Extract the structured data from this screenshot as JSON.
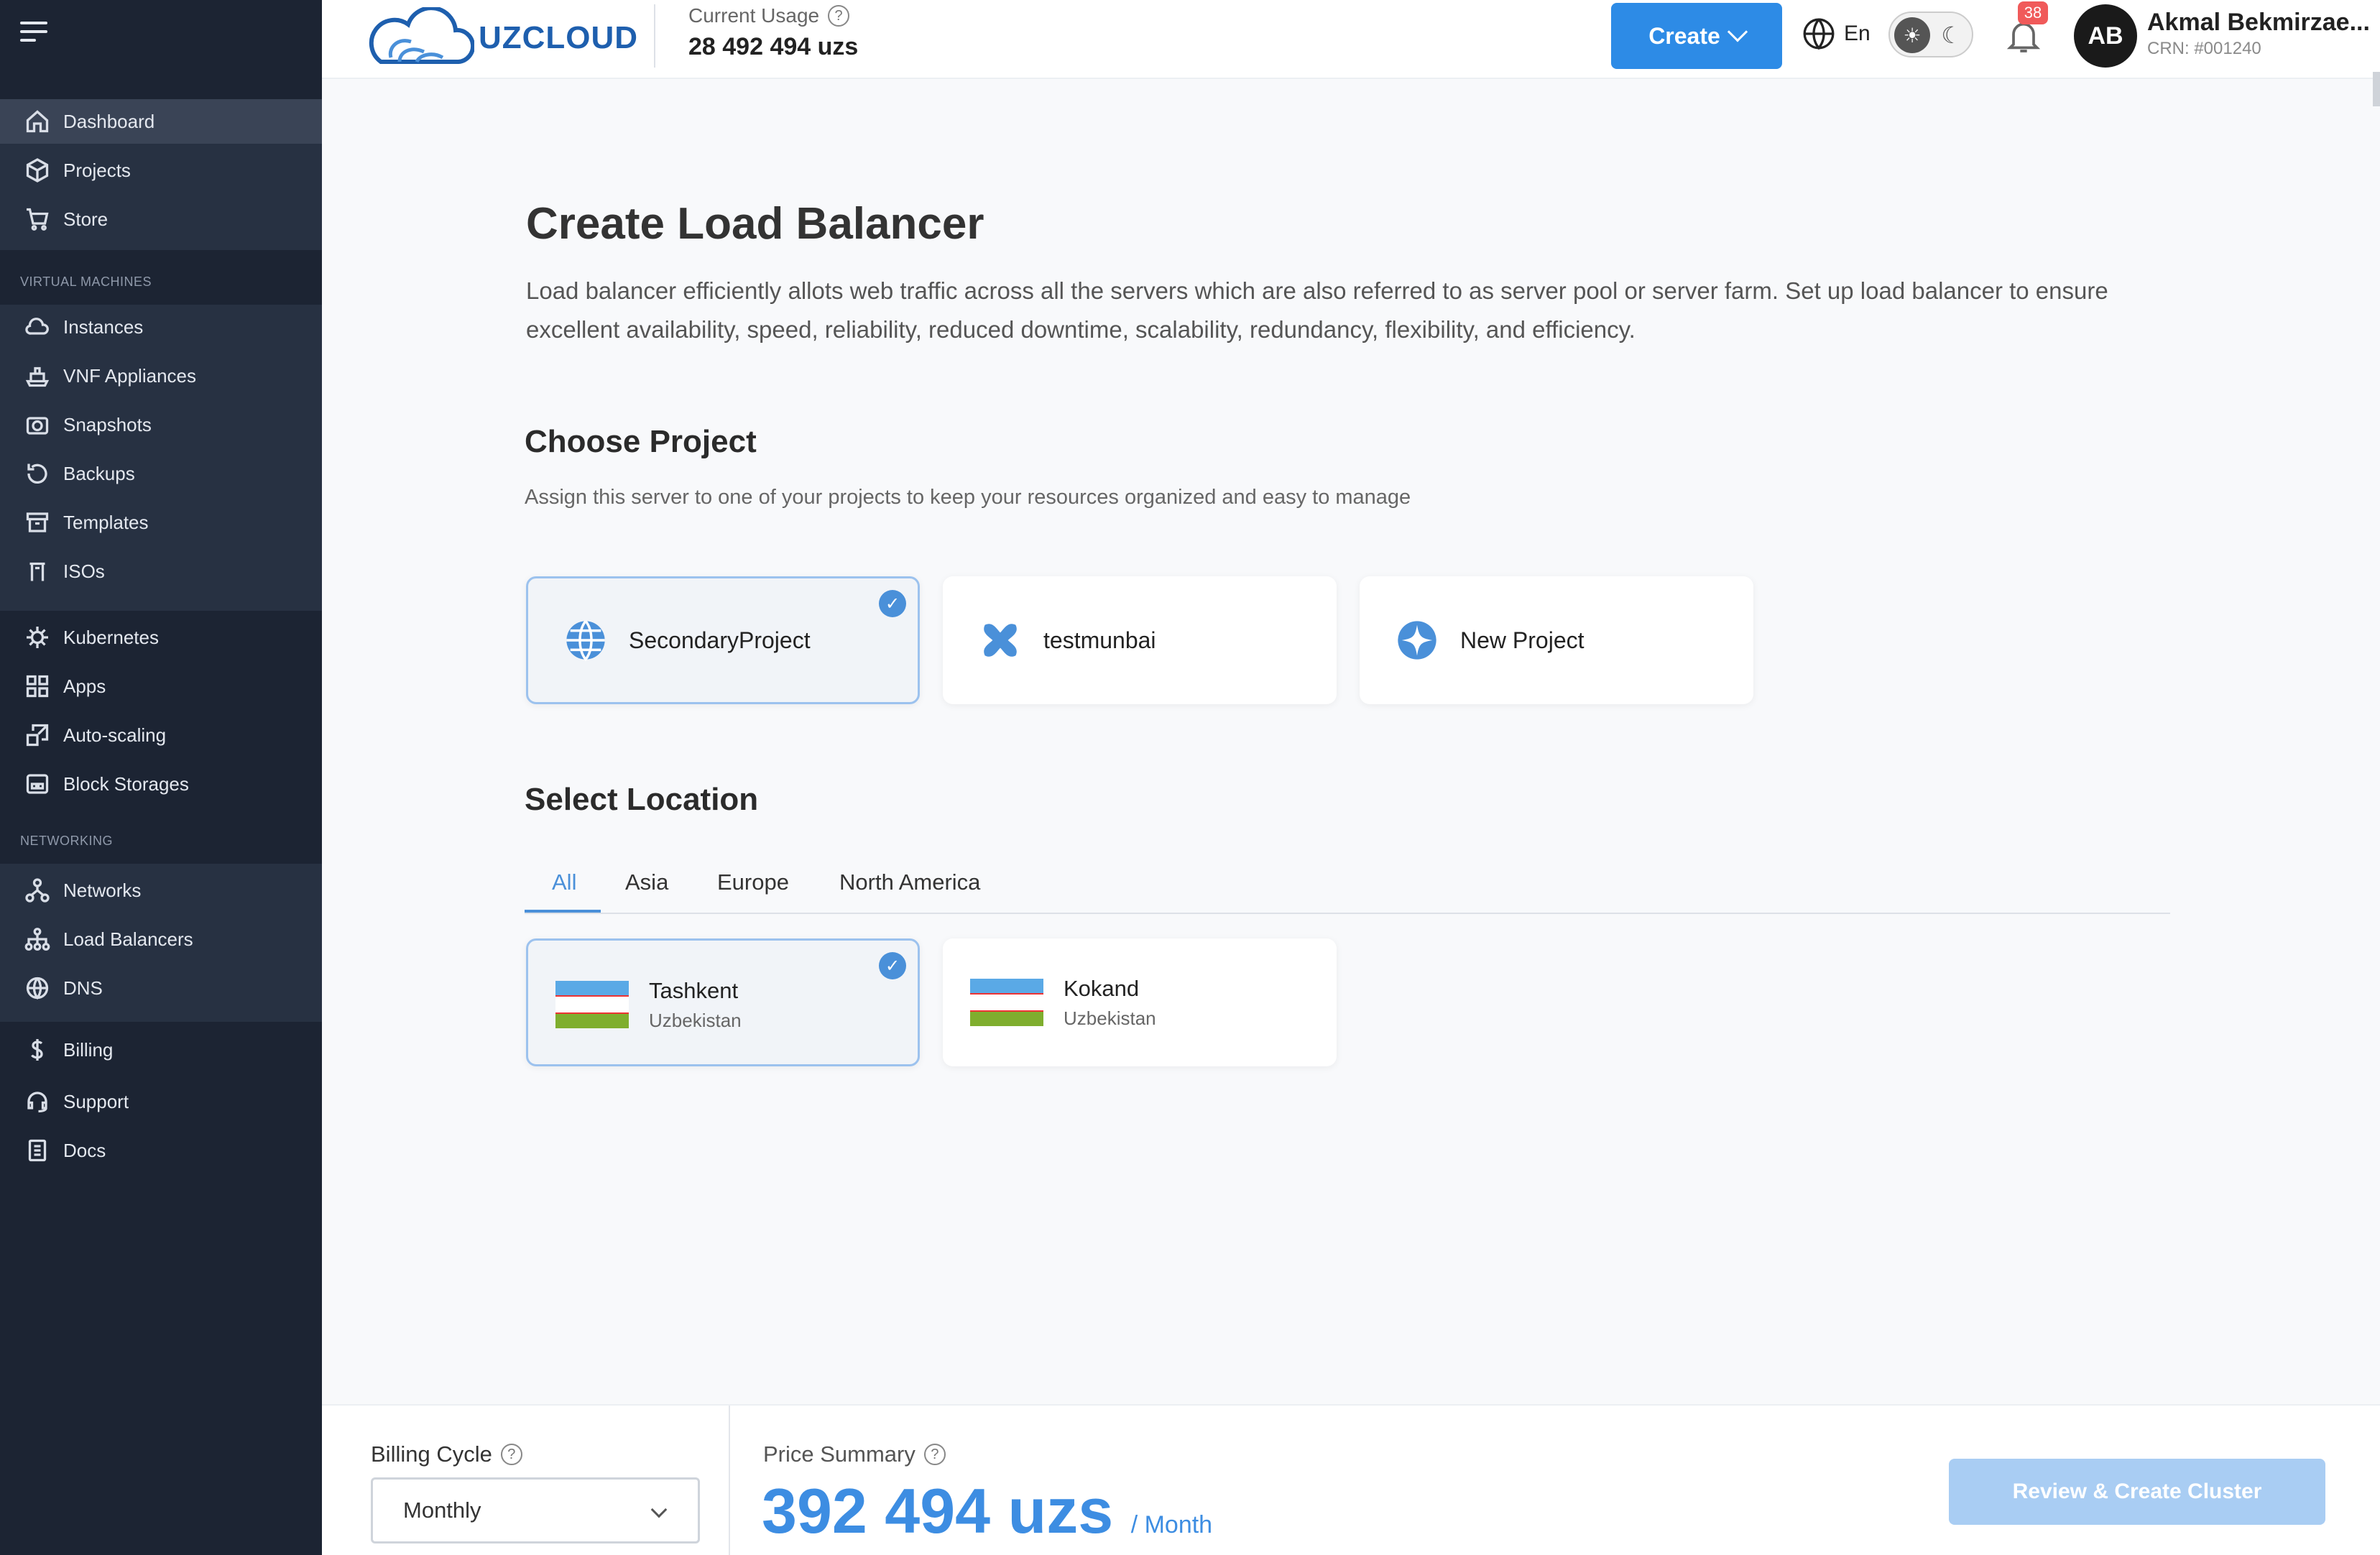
{
  "brand": {
    "name": "UZCLOUD"
  },
  "header": {
    "usage_label": "Current Usage",
    "usage_value": "28 492 494 uzs",
    "create_label": "Create",
    "language": "En",
    "notifications_count": "38",
    "avatar_initials": "AB",
    "user_name": "Akmal Bekmirzae...",
    "user_crn": "CRN: #001240"
  },
  "sidebar": {
    "top_items": [
      {
        "label": "Dashboard",
        "icon": "home-icon",
        "active": true
      },
      {
        "label": "Projects",
        "icon": "cube-icon"
      },
      {
        "label": "Store",
        "icon": "cart-icon"
      }
    ],
    "sections": {
      "virtual_machines": "VIRTUAL MACHINES",
      "networking": "NETWORKING"
    },
    "vm_items": [
      {
        "label": "Instances",
        "icon": "cloud-icon"
      },
      {
        "label": "VNF Appliances",
        "icon": "ship-icon"
      },
      {
        "label": "Snapshots",
        "icon": "camera-icon"
      },
      {
        "label": "Backups",
        "icon": "history-icon"
      },
      {
        "label": "Templates",
        "icon": "archive-icon"
      },
      {
        "label": "ISOs",
        "icon": "iso-icon"
      }
    ],
    "k8s_items": [
      {
        "label": "Kubernetes",
        "icon": "helm-icon"
      },
      {
        "label": "Apps",
        "icon": "grid-icon"
      },
      {
        "label": "Auto-scaling",
        "icon": "scale-icon"
      },
      {
        "label": "Block Storages",
        "icon": "storage-icon"
      }
    ],
    "net_items": [
      {
        "label": "Networks",
        "icon": "network-icon"
      },
      {
        "label": "Load Balancers",
        "icon": "sitemap-icon"
      },
      {
        "label": "DNS",
        "icon": "globe-icon"
      }
    ],
    "bottom_items": [
      {
        "label": "Billing",
        "icon": "dollar-icon"
      },
      {
        "label": "Support",
        "icon": "headset-icon"
      },
      {
        "label": "Docs",
        "icon": "document-icon"
      }
    ]
  },
  "main": {
    "title": "Create Load Balancer",
    "description": "Load balancer efficiently allots web traffic across all the servers which are also referred to as server pool or server farm. Set up load balancer to ensure excellent availability, speed, reliability, reduced downtime, scalability, redundancy, flexibility, and efficiency.",
    "project_section": {
      "title": "Choose Project",
      "subtitle": "Assign this server to one of your projects to keep your resources organized and easy to manage",
      "projects": [
        {
          "label": "SecondaryProject",
          "icon": "globe-icon",
          "selected": true
        },
        {
          "label": "testmunbai",
          "icon": "puzzle-icon",
          "selected": false
        },
        {
          "label": "New Project",
          "icon": "sparkle-icon",
          "selected": false
        }
      ]
    },
    "location_section": {
      "title": "Select Location",
      "tabs": [
        "All",
        "Asia",
        "Europe",
        "North America"
      ],
      "active_tab": "All",
      "locations": [
        {
          "city": "Tashkent",
          "country": "Uzbekistan",
          "selected": true
        },
        {
          "city": "Kokand",
          "country": "Uzbekistan",
          "selected": false
        }
      ]
    }
  },
  "footer": {
    "billing_label": "Billing Cycle",
    "billing_value": "Monthly",
    "price_label": "Price Summary",
    "price_value": "392 494 uzs",
    "price_unit": "/ Month",
    "review_label": "Review & Create Cluster"
  },
  "colors": {
    "accent": "#2d8be6",
    "sidebar_bg": "#1c2433",
    "price": "#3d8de2",
    "badge": "#f05a5a"
  }
}
